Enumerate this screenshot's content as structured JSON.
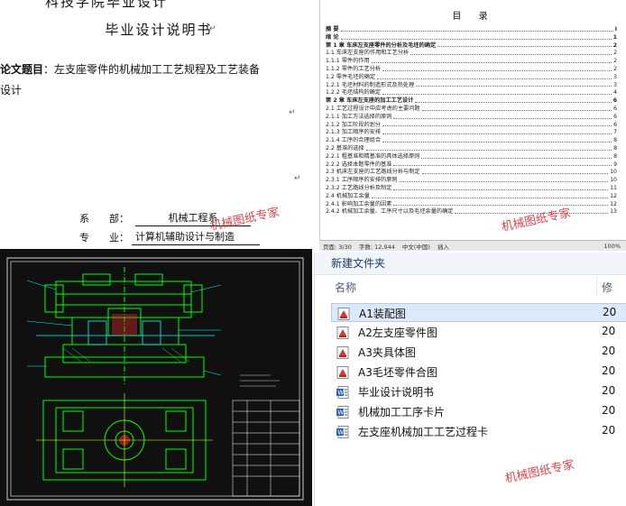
{
  "cover": {
    "top_cut_text": "科技学院毕业设计",
    "title": "毕业设计说明书",
    "thesis_label": "论文题目",
    "thesis_title_part1": "左支座零件的机械加工工艺规程及工艺装备",
    "thesis_title_part2": "设计",
    "dept_label": "系　　部：",
    "dept_value": "机械工程系",
    "major_label": "专　　业：",
    "major_value": "计算机辅助设计与制造"
  },
  "watermark": "机械图纸专家",
  "toc": {
    "title": "目 录",
    "entries": [
      {
        "text": "摘 要",
        "page": "I",
        "chapter": true
      },
      {
        "text": "绪 论",
        "page": "1",
        "chapter": true
      },
      {
        "text": "第 1 章  车床左支座零件的分析及毛坯的确定",
        "page": "2",
        "chapter": true
      },
      {
        "text": "1.1 车床左支座的作用和工艺分析",
        "page": "2",
        "chapter": false
      },
      {
        "text": "1.1.1 零件的作用",
        "page": "2",
        "chapter": false
      },
      {
        "text": "1.1.2 零件的工艺分析",
        "page": "2",
        "chapter": false
      },
      {
        "text": "1.2 零件毛坯的确定",
        "page": "3",
        "chapter": false
      },
      {
        "text": "1.2.1 毛坯材料的制造形式及热处理",
        "page": "3",
        "chapter": false
      },
      {
        "text": "1.2.2 毛坯结构的确定",
        "page": "4",
        "chapter": false
      },
      {
        "text": "第 2 章  车床左支座的加工工艺设计",
        "page": "6",
        "chapter": true
      },
      {
        "text": "2.1 工艺过程设计中应考虑的主要问题",
        "page": "6",
        "chapter": false
      },
      {
        "text": "2.1.1 加工方法选择的原则",
        "page": "6",
        "chapter": false
      },
      {
        "text": "2.1.2 加工阶段的划分",
        "page": "6",
        "chapter": false
      },
      {
        "text": "2.1.3 加工顺序的安排",
        "page": "7",
        "chapter": false
      },
      {
        "text": "2.1.4 工序的合理组合",
        "page": "8",
        "chapter": false
      },
      {
        "text": "2.2 基准的选择",
        "page": "8",
        "chapter": false
      },
      {
        "text": "2.2.1 粗基准和精基准的具体选择原则",
        "page": "8",
        "chapter": false
      },
      {
        "text": "2.2.2 选择本题零件的基准",
        "page": "9",
        "chapter": false
      },
      {
        "text": "2.3 机床左支座的工艺路线分析与制定",
        "page": "10",
        "chapter": false
      },
      {
        "text": "2.3.1 工序顺序的安排的原则",
        "page": "10",
        "chapter": false
      },
      {
        "text": "2.3.2 工艺路线分析及制定",
        "page": "11",
        "chapter": false
      },
      {
        "text": "2.4 机械加工余量",
        "page": "12",
        "chapter": false
      },
      {
        "text": "2.4.1 影响加工余量的因素",
        "page": "12",
        "chapter": false
      },
      {
        "text": "2.4.2 机械加工余量、工序尺寸以及毛坯余量的确定",
        "page": "13",
        "chapter": false
      }
    ],
    "status": {
      "page": "页面: 3/30",
      "words": "字数: 12,944",
      "lang": "中文(中国)",
      "mode": "插入",
      "zoom": "100%"
    }
  },
  "explorer": {
    "folder": "新建文件夹",
    "col_name": "名称",
    "col_modified": "修",
    "files": [
      {
        "name": "A1装配图",
        "date": "20",
        "type": "drawing",
        "selected": true
      },
      {
        "name": "A2左支座零件图",
        "date": "20",
        "type": "drawing",
        "selected": false
      },
      {
        "name": "A3夹具体图",
        "date": "20",
        "type": "drawing",
        "selected": false
      },
      {
        "name": "A3毛坯零件合图",
        "date": "20",
        "type": "drawing",
        "selected": false
      },
      {
        "name": "毕业设计说明书",
        "date": "20",
        "type": "doc",
        "selected": false
      },
      {
        "name": "机械加工工序卡片",
        "date": "20",
        "type": "doc",
        "selected": false
      },
      {
        "name": "左支座机械加工工艺过程卡",
        "date": "20",
        "type": "doc",
        "selected": false
      }
    ]
  },
  "colors": {
    "cad_bg": "#101010",
    "cad_line": "#00ff00",
    "watermark": "#d4303a",
    "selected_row": "#dbe9fb"
  }
}
